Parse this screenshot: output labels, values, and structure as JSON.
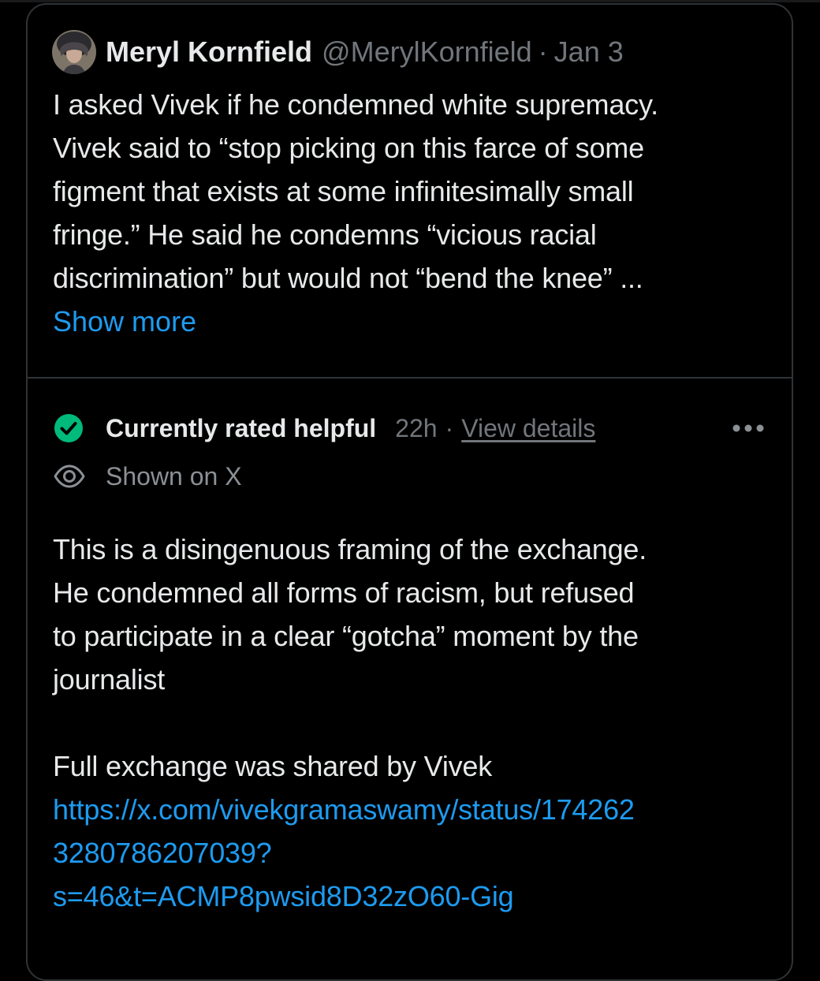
{
  "tweet": {
    "author_name": "Meryl Kornfield",
    "handle": "@MerylKornfield",
    "separator": "·",
    "date": "Jan 3",
    "text": "I asked Vivek if he condemned white supremacy.\nVivek said to “stop picking on this farce of some\nfigment that exists at some infinitesimally small\nfringe.” He said he condemns “vicious racial\ndiscrimination” but would not “bend the knee” ...",
    "show_more": "Show more"
  },
  "community_note": {
    "status": "Currently rated helpful",
    "age": "22h",
    "separator": "·",
    "view_details": "View details",
    "visibility": "Shown on X",
    "body": "This is a disingenuous framing of the exchange.\nHe condemned all forms of racism, but refused\nto participate in a clear “gotcha” moment by the\njournalist\n\nFull exchange was shared by Vivek",
    "link": "https://x.com/vivekgramaswamy/status/174262\n3280786207039?\ns=46&t=ACMP8pwsid8D32zO60-Gig"
  },
  "icons": {
    "status": "check-circle-icon",
    "more": "more-horizontal-icon",
    "visibility": "eye-icon"
  },
  "colors": {
    "background": "#000000",
    "text_primary": "#e7e9ea",
    "text_secondary": "#71767b",
    "link": "#1d9bf0",
    "helpful_green": "#00ba7c",
    "border": "#2f3336"
  }
}
